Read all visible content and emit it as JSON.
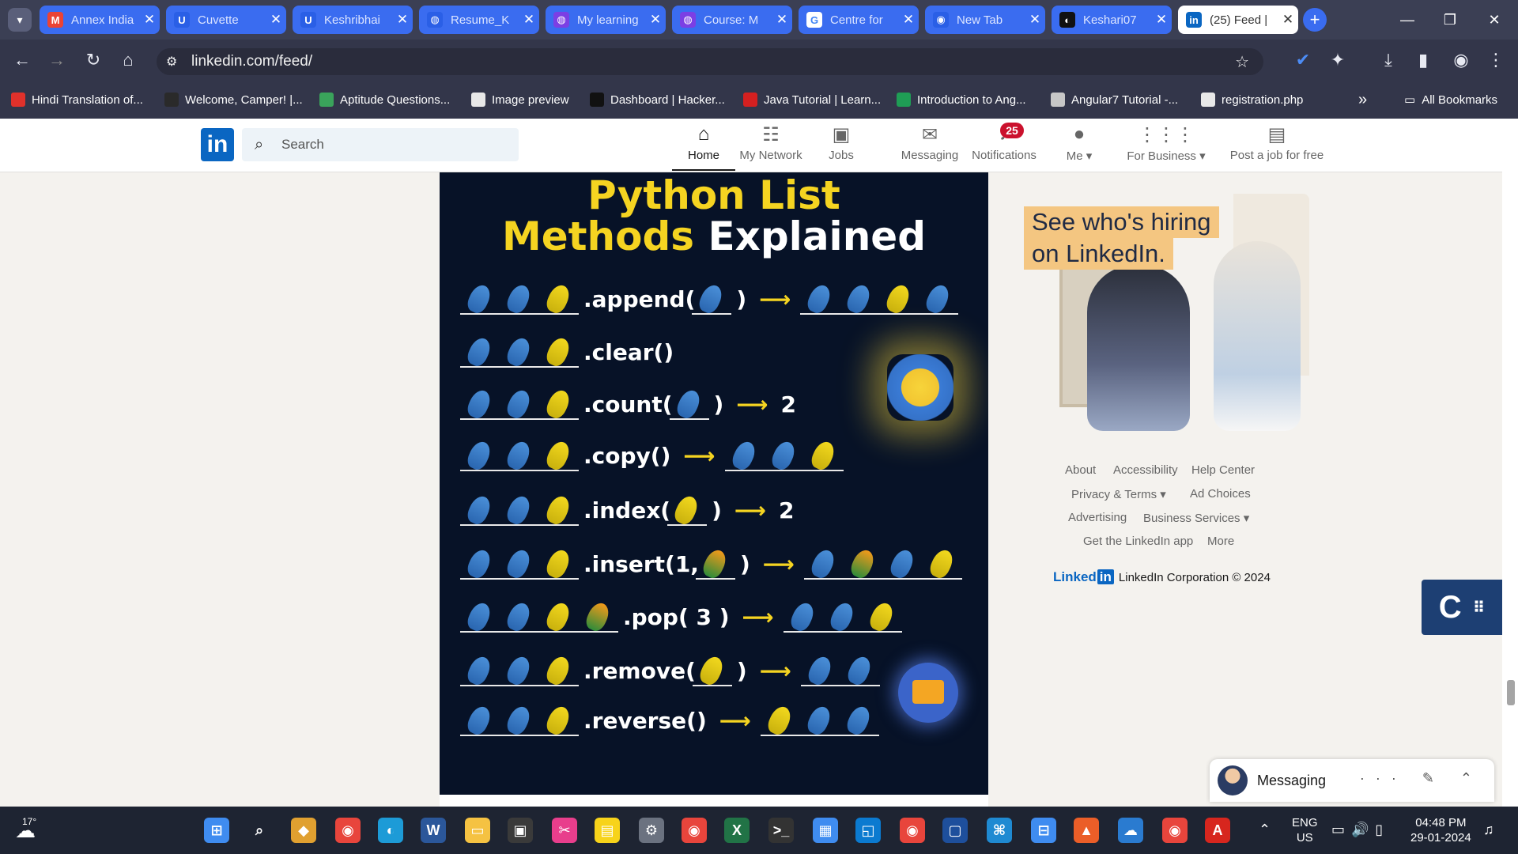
{
  "browser": {
    "tabs": [
      {
        "title": "Annex India",
        "icon": "gmail-icon",
        "color": "#ea4335",
        "glyph": "M"
      },
      {
        "title": "Cuvette",
        "icon": "cuvette-icon",
        "color": "#2a5fe6",
        "glyph": "U"
      },
      {
        "title": "Keshribhai",
        "icon": "cuvette-icon",
        "color": "#2a5fe6",
        "glyph": "U"
      },
      {
        "title": "Resume_K",
        "icon": "globe-icon",
        "color": "#2a5fe6",
        "glyph": "◍"
      },
      {
        "title": "My learning",
        "icon": "course-icon",
        "color": "#7b3fe4",
        "glyph": "◍"
      },
      {
        "title": "Course: M",
        "icon": "course-icon",
        "color": "#7b3fe4",
        "glyph": "◍"
      },
      {
        "title": "Centre for",
        "icon": "google-icon",
        "color": "#ffffff",
        "glyph": "G"
      },
      {
        "title": "New Tab",
        "icon": "chrome-icon",
        "color": "#2a5fe6",
        "glyph": "◉"
      },
      {
        "title": "Keshari07",
        "icon": "github-icon",
        "color": "#111111",
        "glyph": "◐"
      },
      {
        "title": "(25) Feed |",
        "icon": "linkedin-icon",
        "color": "#0a66c2",
        "glyph": "in"
      }
    ],
    "url": "linkedin.com/feed/",
    "bookmarks": [
      {
        "label": "Hindi Translation of...",
        "color": "#e0312b"
      },
      {
        "label": "Welcome, Camper! |...",
        "color": "#2a2a2a"
      },
      {
        "label": "Aptitude Questions...",
        "color": "#3aa35b"
      },
      {
        "label": "Image preview",
        "color": "#e8e8e8"
      },
      {
        "label": "Dashboard | Hacker...",
        "color": "#111111"
      },
      {
        "label": "Java Tutorial | Learn...",
        "color": "#d42020"
      },
      {
        "label": "Introduction to Ang...",
        "color": "#1f9d55"
      },
      {
        "label": "Angular7 Tutorial -...",
        "color": "#c7c7c7"
      },
      {
        "label": "registration.php",
        "color": "#e8e8e8"
      }
    ],
    "bookmarks_more": "»",
    "all_bookmarks": "All Bookmarks"
  },
  "linkedin": {
    "logo": "in",
    "search_placeholder": "Search",
    "nav": [
      {
        "label": "Home",
        "icon": "home-icon",
        "glyph": "⌂"
      },
      {
        "label": "My Network",
        "icon": "network-icon",
        "glyph": "☷"
      },
      {
        "label": "Jobs",
        "icon": "jobs-icon",
        "glyph": "▣"
      },
      {
        "label": "Messaging",
        "icon": "messaging-icon",
        "glyph": "✉"
      },
      {
        "label": "Notifications",
        "icon": "bell-icon",
        "glyph": "♪"
      },
      {
        "label": "Me ▾",
        "icon": "avatar-icon",
        "glyph": "●"
      },
      {
        "label": "For Business ▾",
        "icon": "grid-icon",
        "glyph": "⋮⋮⋮"
      },
      {
        "label": "Post a job for free",
        "icon": "briefcase-icon",
        "glyph": "▤"
      }
    ],
    "notifications_badge": "25",
    "post": {
      "title_line1": "Python List",
      "title_line2_a": "Methods",
      "title_line2_b": "Explained",
      "rows": [
        {
          "method": ".append(",
          "close": ")",
          "result": ""
        },
        {
          "method": ".clear()",
          "close": "",
          "result": ""
        },
        {
          "method": ".count(",
          "close": ")",
          "result": "2"
        },
        {
          "method": ".copy()",
          "close": "",
          "result": ""
        },
        {
          "method": ".index(",
          "close": ")",
          "result": "2"
        },
        {
          "method": ".insert(1,",
          "close": ")",
          "result": ""
        },
        {
          "method": ".pop(  3  )",
          "close": "",
          "result": ""
        },
        {
          "method": ".remove(",
          "close": ")",
          "result": ""
        },
        {
          "method": ".reverse()",
          "close": "",
          "result": ""
        }
      ]
    },
    "ad": {
      "headline_line1": "See who's hiring",
      "headline_line2": "on LinkedIn."
    },
    "footer": {
      "about": "About",
      "accessibility": "Accessibility",
      "help_center": "Help Center",
      "privacy_terms": "Privacy & Terms ▾",
      "ad_choices": "Ad Choices",
      "advertising": "Advertising",
      "business_services": "Business Services ▾",
      "get_app": "Get the LinkedIn app",
      "more": "More",
      "brand": "Linked",
      "brand_in": "in",
      "copyright": "LinkedIn Corporation © 2024"
    },
    "messaging": {
      "label": "Messaging",
      "icons": "··· ✎ ⌃"
    }
  },
  "taskbar": {
    "weather": "17°",
    "lang_1": "ENG",
    "lang_2": "US",
    "time": "04:48 PM",
    "date": "29-01-2024"
  }
}
